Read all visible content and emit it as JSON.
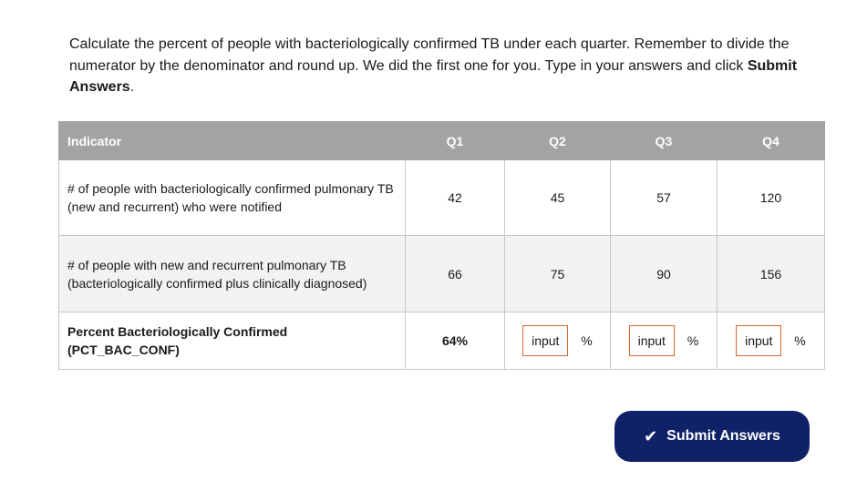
{
  "instructions": {
    "text": "Calculate the percent of people with bacteriologically confirmed TB under each quarter. Remember to divide the numerator by the denominator and round up. We did the first one for you. Type in your answers and click ",
    "bold": "Submit Answers",
    "end": "."
  },
  "table": {
    "headers": [
      "Indicator",
      "Q1",
      "Q2",
      "Q3",
      "Q4"
    ],
    "rows": [
      {
        "label": "# of people with bacteriologically confirmed pulmonary TB (new and recurrent) who were notified",
        "values": [
          "42",
          "45",
          "57",
          "120"
        ]
      },
      {
        "label": "# of people with new and recurrent pulmonary TB (bacteriologically confirmed plus clinically diagnosed)",
        "values": [
          "66",
          "75",
          "90",
          "156"
        ]
      },
      {
        "label": "Percent Bacteriologically Confirmed (PCT_BAC_CONF)",
        "q1_answer": "64%",
        "input_placeholder": "input",
        "percent_sign": "%"
      }
    ]
  },
  "submit": {
    "label": "Submit Answers",
    "icon": "check-icon",
    "icon_glyph": "✔",
    "color": "#0f2167"
  },
  "colors": {
    "header_bg": "#a3a3a3",
    "input_border": "#d9652b",
    "answer_text": "#1b2a6b",
    "alt_row_bg": "#f2f2f2"
  }
}
